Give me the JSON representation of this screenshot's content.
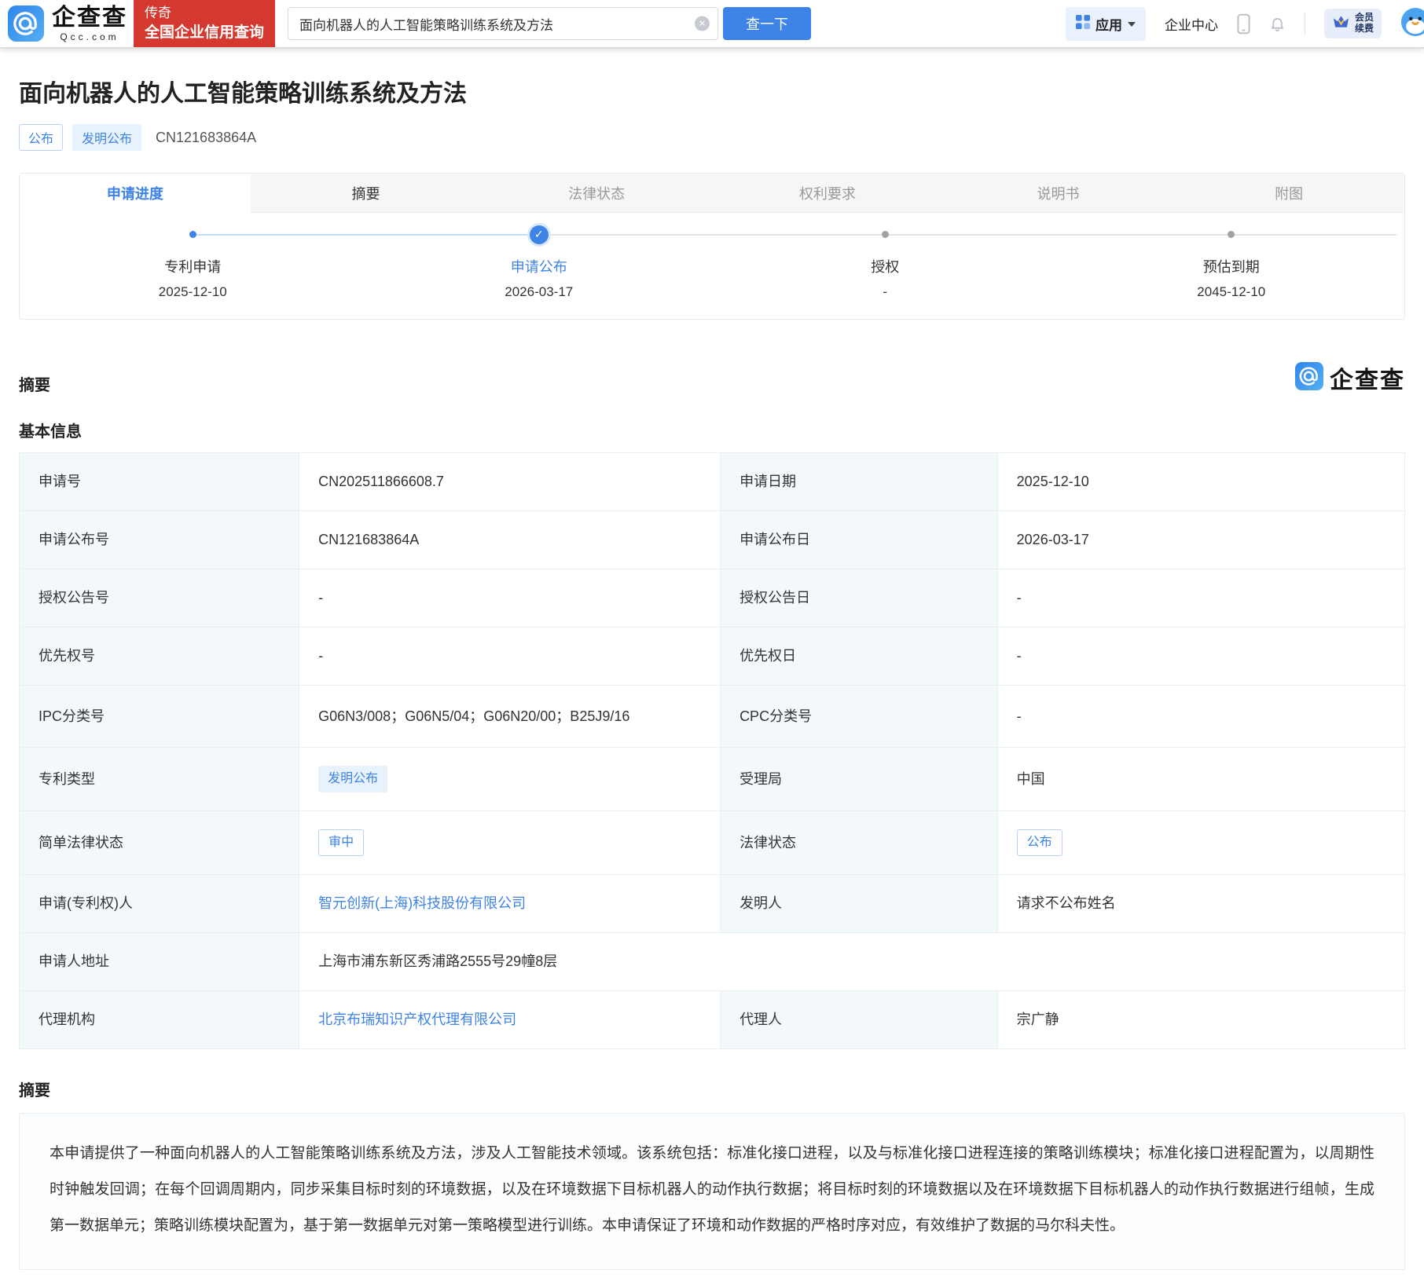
{
  "colors": {
    "accent": "#3e83e6",
    "accent-light": "#e8f2fc",
    "brand-red": "#d5382e",
    "tag-border": "#b7d3f3",
    "label-bg": "#f3f8fb",
    "line": "#e9eef2",
    "tab-bg": "#f6f6f6",
    "text-dark": "#333333",
    "text-gray": "#999999"
  },
  "header": {
    "logo": {
      "name": "企查查",
      "domain": "Qcc.com"
    },
    "promo_badge": {
      "line1": "传奇",
      "line2": "全国企业信用查询"
    },
    "search": {
      "value": "面向机器人的人工智能策略训练系统及方法",
      "button": "查一下",
      "clear_icon": "circle-x"
    },
    "nav": {
      "apps": "应用",
      "enterprise_center": "企业中心",
      "vip_line1": "会员",
      "vip_line2": "续费"
    }
  },
  "patent": {
    "title": "面向机器人的人工智能策略训练系统及方法",
    "status_tag": "公布",
    "type_tag": "发明公布",
    "publication_no": "CN121683864A"
  },
  "tabs": [
    {
      "key": "progress",
      "label": "申请进度",
      "active": true
    },
    {
      "key": "abstract",
      "label": "摘要",
      "emphasis": true
    },
    {
      "key": "legal-status",
      "label": "法律状态"
    },
    {
      "key": "claims",
      "label": "权利要求"
    },
    {
      "key": "description",
      "label": "说明书"
    },
    {
      "key": "drawings",
      "label": "附图"
    }
  ],
  "timeline": [
    {
      "key": "application",
      "label": "专利申请",
      "date": "2025-12-10",
      "state": "done"
    },
    {
      "key": "publication",
      "label": "申请公布",
      "date": "2026-03-17",
      "state": "current"
    },
    {
      "key": "grant",
      "label": "授权",
      "date": "-",
      "state": "pending"
    },
    {
      "key": "estimated-expiry",
      "label": "预估到期",
      "date": "2045-12-10",
      "state": "pending"
    }
  ],
  "summary_section": {
    "title": "摘要",
    "brand": "企查查"
  },
  "basic_info": {
    "title": "基本信息",
    "rows": [
      [
        {
          "key": "application-no",
          "label": "申请号",
          "value": "CN202511866608.7"
        },
        {
          "key": "application-date",
          "label": "申请日期",
          "value": "2025-12-10"
        }
      ],
      [
        {
          "key": "publication-no",
          "label": "申请公布号",
          "value": "CN121683864A"
        },
        {
          "key": "publication-date",
          "label": "申请公布日",
          "value": "2026-03-17"
        }
      ],
      [
        {
          "key": "grant-no",
          "label": "授权公告号",
          "value": "-"
        },
        {
          "key": "grant-date",
          "label": "授权公告日",
          "value": "-"
        }
      ],
      [
        {
          "key": "priority-no",
          "label": "优先权号",
          "value": "-"
        },
        {
          "key": "priority-date",
          "label": "优先权日",
          "value": "-"
        }
      ],
      [
        {
          "key": "ipc",
          "label": "IPC分类号",
          "value": "G06N3/008；G06N5/04；G06N20/00；B25J9/16",
          "narrow": true
        },
        {
          "key": "cpc",
          "label": "CPC分类号",
          "value": "-"
        }
      ],
      [
        {
          "key": "patent-type",
          "label": "专利类型",
          "value": "发明公布",
          "type": "tag-filled"
        },
        {
          "key": "office",
          "label": "受理局",
          "value": "中国"
        }
      ],
      [
        {
          "key": "simple-legal-status",
          "label": "简单法律状态",
          "value": "审中",
          "type": "tag-outlined"
        },
        {
          "key": "legal-status",
          "label": "法律状态",
          "value": "公布",
          "type": "tag-outlined"
        }
      ],
      [
        {
          "key": "applicant",
          "label": "申请(专利权)人",
          "value": "智元创新(上海)科技股份有限公司",
          "type": "link"
        },
        {
          "key": "inventor",
          "label": "发明人",
          "value": "请求不公布姓名"
        }
      ],
      [
        {
          "key": "applicant-address",
          "label": "申请人地址",
          "value": "上海市浦东新区秀浦路2555号29幢8层",
          "span": 3
        }
      ],
      [
        {
          "key": "agency",
          "label": "代理机构",
          "value": "北京布瑞知识产权代理有限公司",
          "type": "link"
        },
        {
          "key": "agent",
          "label": "代理人",
          "value": "宗广静"
        }
      ]
    ]
  },
  "abstract": {
    "title": "摘要",
    "text": "本申请提供了一种面向机器人的人工智能策略训练系统及方法，涉及人工智能技术领域。该系统包括：标准化接口进程，以及与标准化接口进程连接的策略训练模块；标准化接口进程配置为，以周期性时钟触发回调；在每个回调周期内，同步采集目标时刻的环境数据，以及在环境数据下目标机器人的动作执行数据；将目标时刻的环境数据以及在环境数据下目标机器人的动作执行数据进行组帧，生成第一数据单元；策略训练模块配置为，基于第一数据单元对第一策略模型进行训练。本申请保证了环境和动作数据的严格时序对应，有效维护了数据的马尔科夫性。"
  }
}
